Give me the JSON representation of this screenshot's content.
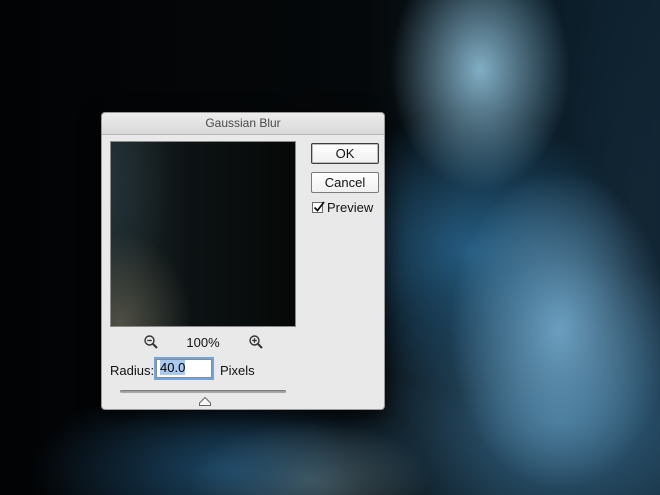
{
  "dialog": {
    "title": "Gaussian Blur",
    "ok_label": "OK",
    "cancel_label": "Cancel",
    "preview_label": "Preview",
    "preview_checked": true,
    "zoom": {
      "level": "100%",
      "zoom_out_icon": "zoom-out-magnifier-icon",
      "zoom_in_icon": "zoom-in-magnifier-icon"
    },
    "radius": {
      "label": "Radius:",
      "value": "40.0",
      "unit": "Pixels",
      "slider_fraction": 0.51
    }
  },
  "colors": {
    "dialog_bg": "#e9e9e9",
    "focus_ring": "#6fa6e0",
    "selection": "#a9c9ee"
  }
}
